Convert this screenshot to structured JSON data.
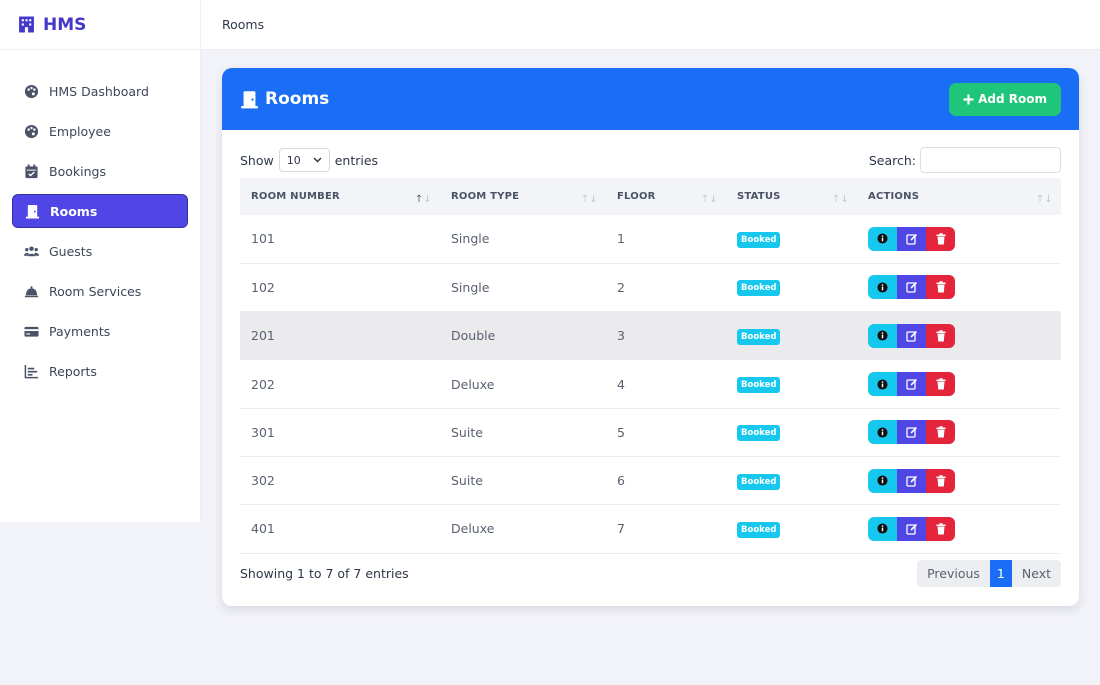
{
  "brand": "HMS",
  "breadcrumb": "Rooms",
  "sidebar": {
    "items": [
      {
        "label": "HMS Dashboard",
        "icon": "palette-icon"
      },
      {
        "label": "Employee",
        "icon": "palette-icon"
      },
      {
        "label": "Bookings",
        "icon": "calendar-icon"
      },
      {
        "label": "Rooms",
        "icon": "door-icon"
      },
      {
        "label": "Guests",
        "icon": "users-icon"
      },
      {
        "label": "Room Services",
        "icon": "bell-icon"
      },
      {
        "label": "Payments",
        "icon": "credit-card-icon"
      },
      {
        "label": "Reports",
        "icon": "chart-icon"
      }
    ],
    "active": "Rooms"
  },
  "card": {
    "title": "Rooms",
    "add_label": "Add Room"
  },
  "controls": {
    "show_label": "Show",
    "page_size": "10",
    "entries_label": "entries",
    "search_label": "Search:"
  },
  "table": {
    "headers": [
      "ROOM NUMBER",
      "ROOM TYPE",
      "FLOOR",
      "STATUS",
      "ACTIONS"
    ],
    "rows": [
      {
        "number": "101",
        "type": "Single",
        "floor": "1",
        "status": "Booked"
      },
      {
        "number": "102",
        "type": "Single",
        "floor": "2",
        "status": "Booked"
      },
      {
        "number": "201",
        "type": "Double",
        "floor": "3",
        "status": "Booked"
      },
      {
        "number": "202",
        "type": "Deluxe",
        "floor": "4",
        "status": "Booked"
      },
      {
        "number": "301",
        "type": "Suite",
        "floor": "5",
        "status": "Booked"
      },
      {
        "number": "302",
        "type": "Suite",
        "floor": "6",
        "status": "Booked"
      },
      {
        "number": "401",
        "type": "Deluxe",
        "floor": "7",
        "status": "Booked"
      }
    ]
  },
  "footer": {
    "info": "Showing 1 to 7 of 7 entries",
    "prev": "Previous",
    "page": "1",
    "next": "Next"
  },
  "colors": {
    "accent": "#1a6ef5",
    "brand": "#4338ca",
    "active_nav": "#4f46e5",
    "add_button": "#1fc57a",
    "status_badge": "#17c8ee",
    "delete": "#e3243b"
  }
}
